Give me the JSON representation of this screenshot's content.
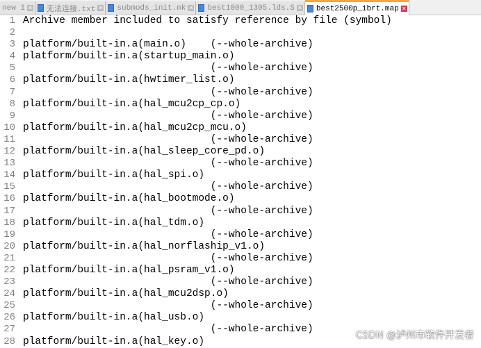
{
  "tabs": [
    {
      "label": "new 1",
      "active": false
    },
    {
      "label": "无法连接.txt",
      "active": false
    },
    {
      "label": "submods_init.mk",
      "active": false
    },
    {
      "label": "best1000_1305.lds.S",
      "active": false
    },
    {
      "label": "best2500p_ibrt.map",
      "active": true
    }
  ],
  "lines": [
    "Archive member included to satisfy reference by file (symbol)",
    "",
    "platform/built-in.a(main.o)    (--whole-archive)",
    "platform/built-in.a(startup_main.o)",
    "                               (--whole-archive)",
    "platform/built-in.a(hwtimer_list.o)",
    "                               (--whole-archive)",
    "platform/built-in.a(hal_mcu2cp_cp.o)",
    "                               (--whole-archive)",
    "platform/built-in.a(hal_mcu2cp_mcu.o)",
    "                               (--whole-archive)",
    "platform/built-in.a(hal_sleep_core_pd.o)",
    "                               (--whole-archive)",
    "platform/built-in.a(hal_spi.o)",
    "                               (--whole-archive)",
    "platform/built-in.a(hal_bootmode.o)",
    "                               (--whole-archive)",
    "platform/built-in.a(hal_tdm.o)",
    "                               (--whole-archive)",
    "platform/built-in.a(hal_norflaship_v1.o)",
    "                               (--whole-archive)",
    "platform/built-in.a(hal_psram_v1.o)",
    "                               (--whole-archive)",
    "platform/built-in.a(hal_mcu2dsp.o)",
    "                               (--whole-archive)",
    "platform/built-in.a(hal_usb.o)",
    "                               (--whole-archive)",
    "platform/built-in.a(hal_key.o)"
  ],
  "watermark": "CSDN @泸州市软件开发者"
}
